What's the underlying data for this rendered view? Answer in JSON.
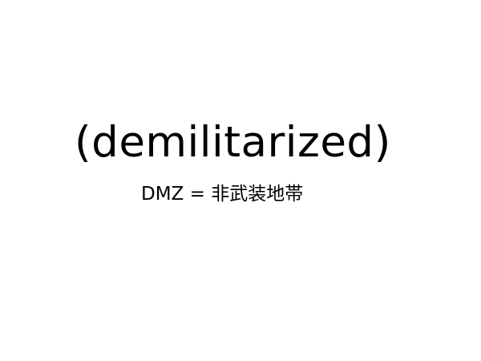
{
  "headline": "(demilitarized)",
  "subline": "DMZ = 非武装地帯"
}
